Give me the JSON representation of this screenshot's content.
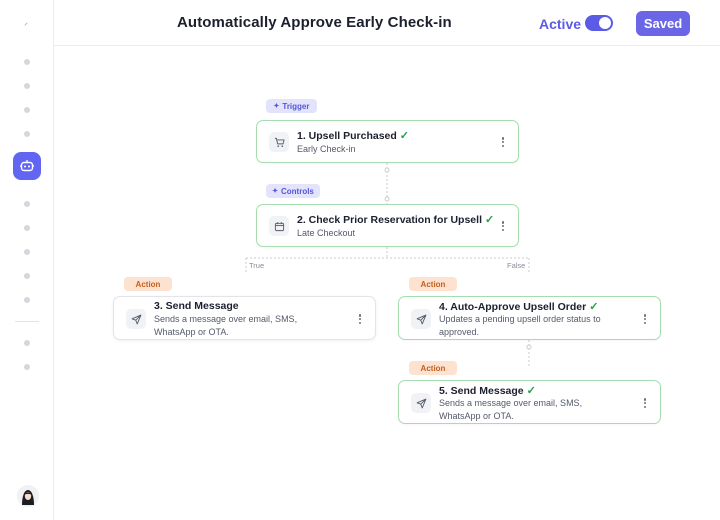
{
  "app": {
    "logo_glyph": "⸝"
  },
  "header": {
    "title": "Automatically Approve Early Check-in",
    "active_label": "Active",
    "toggle_on": true,
    "saved_label": "Saved"
  },
  "sidebar": {
    "active_icon": "robot-icon",
    "avatar_icon": "user-avatar-icon"
  },
  "colors": {
    "accent": "#5b5ce6",
    "success": "#22a045",
    "node_border_success": "#a7dcb1",
    "trigger_tag_bg": "#e3e4fb",
    "action_tag_bg": "#fde2cf"
  },
  "workflow": {
    "tags": {
      "trigger": "Trigger",
      "controls": "Controls",
      "action": "Action"
    },
    "branches": {
      "true_label": "True",
      "false_label": "False"
    },
    "nodes": [
      {
        "title": "1. Upsell Purchased",
        "subtitle": "Early Check-in",
        "icon": "cart-icon",
        "status": "complete"
      },
      {
        "title": "2. Check Prior Reservation for Upsell",
        "subtitle": "Late Checkout",
        "icon": "calendar-icon",
        "status": "complete"
      },
      {
        "title": "3. Send Message",
        "subtitle": "Sends a message over email, SMS, WhatsApp or OTA.",
        "icon": "send-icon",
        "status": "incomplete"
      },
      {
        "title": "4. Auto-Approve Upsell Order",
        "subtitle": "Updates a pending upsell order status to approved.",
        "icon": "send-icon",
        "status": "complete"
      },
      {
        "title": "5. Send Message",
        "subtitle": "Sends a message over email, SMS, WhatsApp or OTA.",
        "icon": "send-icon",
        "status": "complete"
      }
    ],
    "check_glyph": "✓"
  }
}
